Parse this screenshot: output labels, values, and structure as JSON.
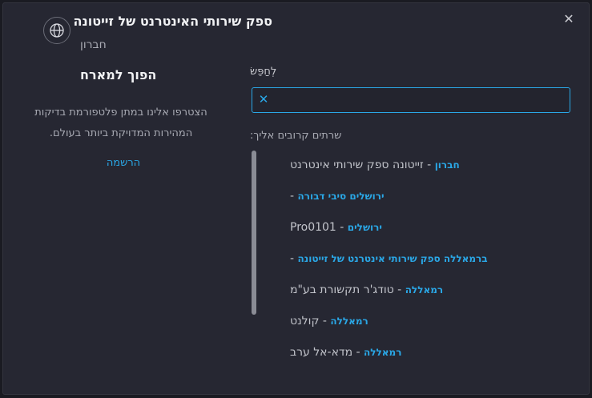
{
  "header": {
    "title": "ספק שירותי האינטרנט של זייטונה",
    "subtitle": "חברון",
    "globe_icon": "globe-icon",
    "close_icon": "close-icon"
  },
  "search": {
    "label": "לְחַפֵּשׂ",
    "value": "",
    "clear_icon": "clear-x-icon"
  },
  "nearby": {
    "label": "שרתים קרובים אליך:",
    "servers": [
      {
        "city": "חברון",
        "sep": " - ",
        "name": "זייטונה ספק שירותי אינטרנט"
      },
      {
        "city": "ירושלים סיבי דבורה",
        "sep": " -",
        "name": ""
      },
      {
        "city": "ירושלים",
        "sep": " - ",
        "name": "Pro0101"
      },
      {
        "city": "ברמאללה ספק שירותי אינטרנט של זייטונה",
        "sep": " -",
        "name": ""
      },
      {
        "city": "רמאללה",
        "sep": " - ",
        "name": "טודג'ר תקשורת בע\"מ"
      },
      {
        "city": "רמאללה",
        "sep": " - ",
        "name": "קולנט"
      },
      {
        "city": "רמאללה",
        "sep": " - ",
        "name": "מדא-אל ערב"
      }
    ]
  },
  "promo": {
    "title": "הפוך למארח",
    "description": "הצטרפו אלינו במתן פלטפורמת בדיקות המהירות המדויקת ביותר בעולם.",
    "signup_label": "הרשמה"
  },
  "colors": {
    "accent": "#2aa7e6",
    "background": "#262732"
  }
}
